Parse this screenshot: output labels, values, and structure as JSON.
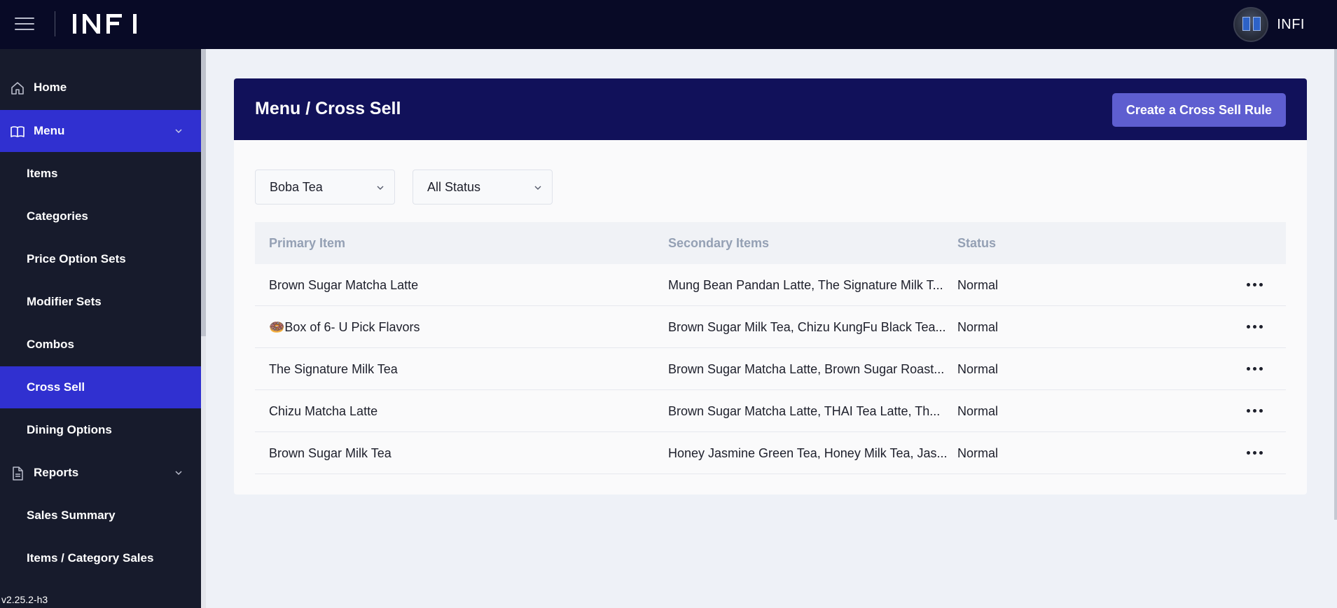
{
  "topbar": {
    "brand": "INFI",
    "user_name": "INFI"
  },
  "sidebar": {
    "items": [
      {
        "label": "Home",
        "icon": "home-icon",
        "type": "top",
        "active": false
      },
      {
        "label": "Menu",
        "icon": "book-icon",
        "type": "top",
        "active": true,
        "expanded": true
      },
      {
        "label": "Items",
        "type": "sub",
        "active": false
      },
      {
        "label": "Categories",
        "type": "sub",
        "active": false
      },
      {
        "label": "Price Option Sets",
        "type": "sub",
        "active": false
      },
      {
        "label": "Modifier Sets",
        "type": "sub",
        "active": false
      },
      {
        "label": "Combos",
        "type": "sub",
        "active": false
      },
      {
        "label": "Cross Sell",
        "type": "sub",
        "active": true
      },
      {
        "label": "Dining Options",
        "type": "sub",
        "active": false
      },
      {
        "label": "Reports",
        "icon": "document-icon",
        "type": "top",
        "active": false,
        "expanded": true
      },
      {
        "label": "Sales Summary",
        "type": "sub",
        "active": false
      },
      {
        "label": "Items / Category Sales",
        "type": "sub",
        "active": false
      }
    ],
    "version": "v2.25.2-h3"
  },
  "main": {
    "title": "Menu / Cross Sell",
    "create_button": "Create a Cross Sell Rule",
    "filters": {
      "category": "Boba Tea",
      "status": "All Status"
    },
    "table": {
      "headers": [
        "Primary Item",
        "Secondary Items",
        "Status"
      ],
      "rows": [
        {
          "primary": "Brown Sugar Matcha Latte",
          "secondary": "Mung Bean Pandan Latte, The Signature Milk T...",
          "status": "Normal"
        },
        {
          "primary": "🍩Box of 6- U Pick Flavors",
          "secondary": "Brown Sugar Milk Tea, Chizu KungFu Black Tea...",
          "status": "Normal"
        },
        {
          "primary": "The Signature Milk Tea",
          "secondary": "Brown Sugar Matcha Latte, Brown Sugar Roast...",
          "status": "Normal"
        },
        {
          "primary": "Chizu Matcha Latte",
          "secondary": "Brown Sugar Matcha Latte, THAI Tea Latte, Th...",
          "status": "Normal"
        },
        {
          "primary": "Brown Sugar Milk Tea",
          "secondary": "Honey Jasmine Green Tea, Honey Milk Tea, Jas...",
          "status": "Normal"
        }
      ]
    }
  },
  "colors": {
    "topbar_bg": "#080a26",
    "sidebar_bg": "#171b2c",
    "active_nav": "#3030d0",
    "card_header": "#11115a",
    "button_bg": "#5e5ed0"
  }
}
